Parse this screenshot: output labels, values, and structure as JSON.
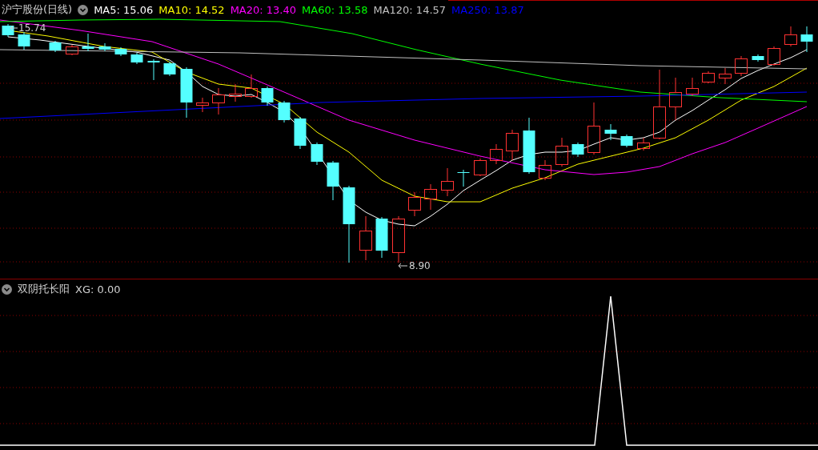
{
  "main_panel": {
    "title": "沪宁股份(日线)",
    "moving_averages": [
      {
        "text": "MA5: 15.06",
        "color": "#ffffff"
      },
      {
        "text": "MA10: 14.52",
        "color": "#ffff00"
      },
      {
        "text": "MA20: 13.40",
        "color": "#ff00ff"
      },
      {
        "text": "MA60: 13.58",
        "color": "#00ff00"
      },
      {
        "text": "MA120: 14.57",
        "color": "#c0c0c0"
      },
      {
        "text": "MA250: 13.87",
        "color": "#0000ff"
      }
    ],
    "high_marker": "15.74",
    "low_marker": "8.90"
  },
  "indicator_panel": {
    "title": "双阴托长阳",
    "reading": "XG: 0.00"
  }
}
